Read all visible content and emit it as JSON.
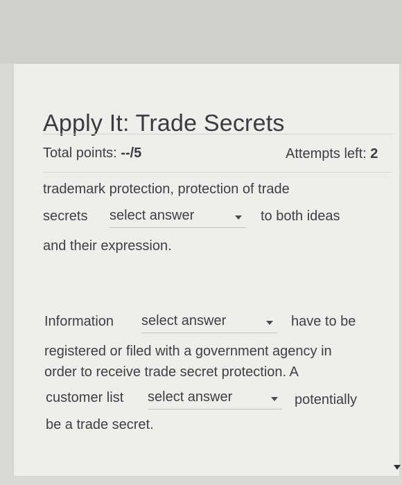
{
  "header": {
    "title": "Apply It: Trade Secrets"
  },
  "score": {
    "points_label": "Total points:",
    "points_value": "--/5",
    "attempts_label": "Attempts left:",
    "attempts_value": "2"
  },
  "question1": {
    "line1": "trademark protection, protection of trade",
    "prefix": "secrets",
    "dropdown": "select answer",
    "suffix": "to both ideas",
    "line3": "and their expression."
  },
  "question2": {
    "prefix": "Information",
    "dropdown1": "select answer",
    "suffix1": "have to be",
    "line2": "registered or filed with a government agency in",
    "line3": "order to receive trade secret protection. A",
    "prefix2": "customer list",
    "dropdown2": "select answer",
    "suffix2": "potentially",
    "line5": "be a trade secret."
  }
}
